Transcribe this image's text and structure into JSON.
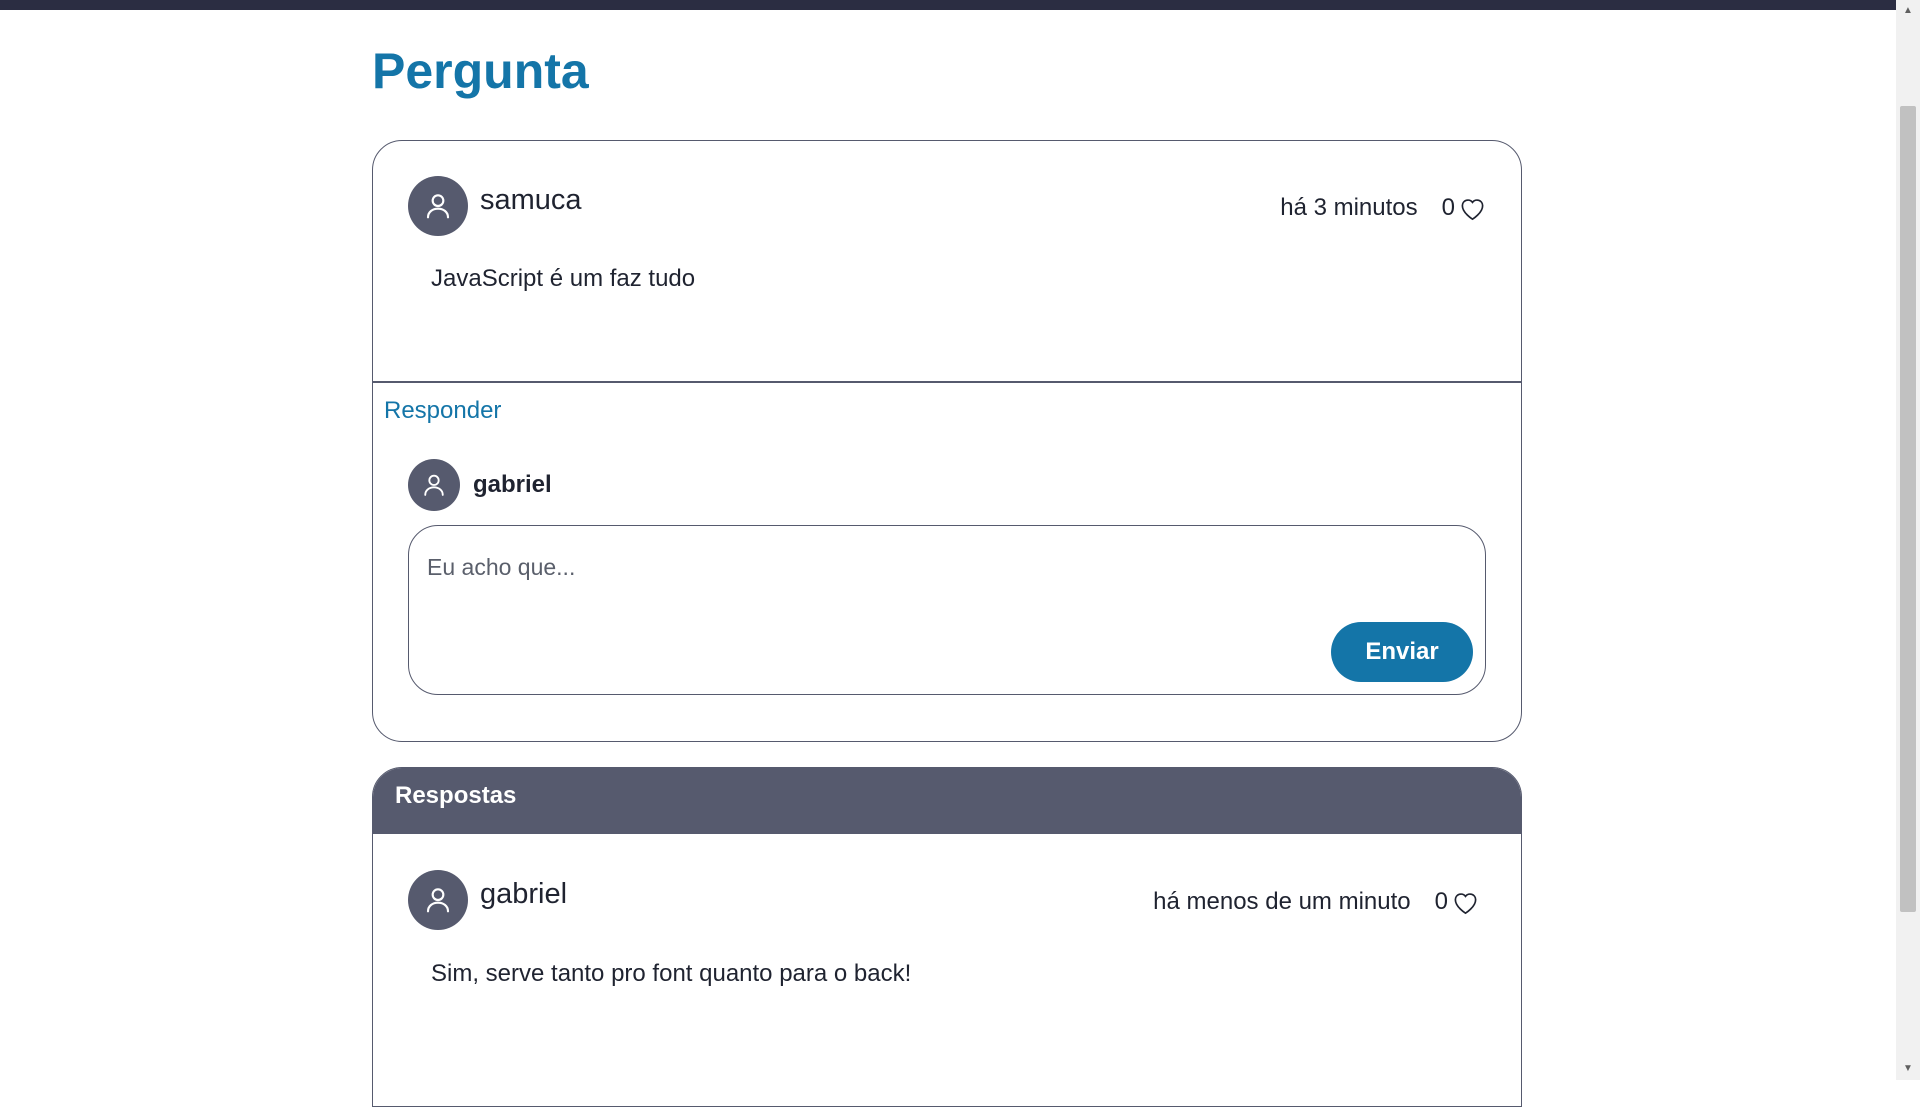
{
  "page": {
    "title": "Pergunta"
  },
  "question": {
    "author": "samuca",
    "time": "há 3 minutos",
    "likes": "0",
    "text": "JavaScript é um faz tudo"
  },
  "reply": {
    "link_label": "Responder",
    "current_user": "gabriel",
    "placeholder": "Eu acho que...",
    "send_label": "Enviar"
  },
  "answers": {
    "header": "Respostas",
    "items": [
      {
        "author": "gabriel",
        "time": "há menos de um minuto",
        "likes": "0",
        "text": "Sim, serve tanto pro font quanto para o back!"
      }
    ]
  },
  "colors": {
    "accent": "#1475a8",
    "dark_slate": "#565a6e",
    "top_bar": "#2b2d42",
    "text": "#1f2330"
  },
  "icons": {
    "avatar": "user-icon",
    "like": "heart-icon"
  }
}
